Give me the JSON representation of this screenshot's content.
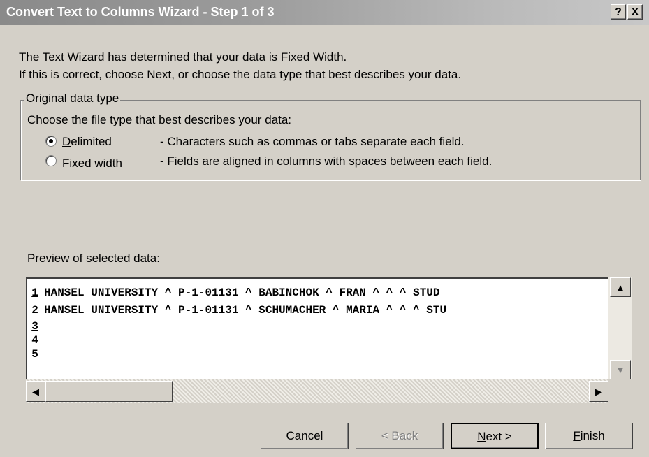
{
  "window": {
    "title": "Convert Text to Columns Wizard - Step 1 of 3",
    "help_btn": "?",
    "close_btn": "X"
  },
  "intro": {
    "line1": "The Text Wizard has determined that your data is Fixed Width.",
    "line2": "If this is correct, choose Next, or choose the data type that best describes your data."
  },
  "group": {
    "legend": "Original data type",
    "prompt": "Choose the file type that best describes your data:",
    "options": [
      {
        "label_pre": "",
        "label_u": "D",
        "label_post": "elimited",
        "desc": "- Characters such as commas or tabs separate each field.",
        "selected": true
      },
      {
        "label_pre": "Fixed ",
        "label_u": "w",
        "label_post": "idth",
        "desc": "- Fields are aligned in columns with spaces between each field.",
        "selected": false
      }
    ]
  },
  "preview": {
    "label": "Preview of selected data:",
    "rows": [
      {
        "num": "1",
        "text": "HANSEL UNIVERSITY ^ P-1-01131 ^ BABINCHOK ^ FRAN ^   ^   ^ STUD"
      },
      {
        "num": "2",
        "text": "HANSEL UNIVERSITY ^ P-1-01131 ^ SCHUMACHER ^ MARIA ^   ^   ^ STU"
      },
      {
        "num": "3",
        "text": ""
      },
      {
        "num": "4",
        "text": ""
      },
      {
        "num": "5",
        "text": ""
      }
    ]
  },
  "buttons": {
    "cancel": "Cancel",
    "back": "< Back",
    "next_u": "N",
    "next_rest": "ext >",
    "finish_u": "F",
    "finish_rest": "inish"
  }
}
